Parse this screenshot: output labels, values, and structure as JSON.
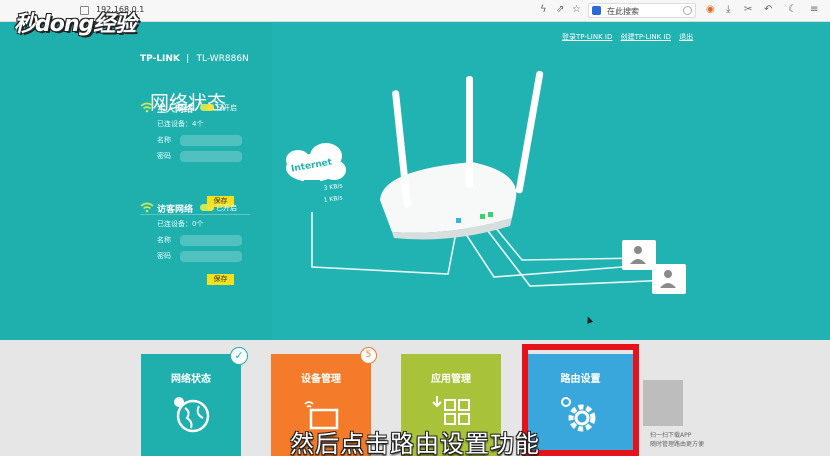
{
  "browser": {
    "url": "192.168.0.1",
    "search_placeholder": "在此搜索"
  },
  "watermark": {
    "logo_text": "秒懂经验"
  },
  "router": {
    "brand": "TP-LINK",
    "model": "TL-WR886N"
  },
  "top_links": [
    "登录TP-LINK ID",
    "创建TP-LINK ID",
    "退出"
  ],
  "status": {
    "title": "网络状态",
    "main_network": {
      "name": "主人网络",
      "toggle_text": "已开启",
      "devices": "已连设备：4个",
      "name_label": "名称",
      "password_label": "密码",
      "save_label": "保存"
    },
    "guest_network": {
      "name": "访客网络",
      "toggle_text": "已开启",
      "devices": "已连设备：0个",
      "name_label": "名称",
      "password_label": "密码",
      "save_label": "保存"
    }
  },
  "illustration": {
    "cloud_label": "Internet",
    "speed_up": "3 KB/s",
    "speed_down": "1 KB/s"
  },
  "nav": {
    "tiles": [
      {
        "label": "网络状态",
        "color": "#1fb0ae"
      },
      {
        "label": "设备管理",
        "color": "#f47b2a",
        "badge": "5"
      },
      {
        "label": "应用管理",
        "color": "#a8c23a"
      },
      {
        "label": "路由设置",
        "color": "#3aa7dc"
      }
    ],
    "app_promo": "扫一扫下载APP\n随时管理路由更方便"
  },
  "subtitle": "然后点击路由设置功能",
  "colors": {
    "teal": "#20b3b1",
    "orange": "#f47b2a",
    "green": "#a8c23a",
    "blue": "#3aa7dc",
    "highlight": "#e5121c"
  }
}
